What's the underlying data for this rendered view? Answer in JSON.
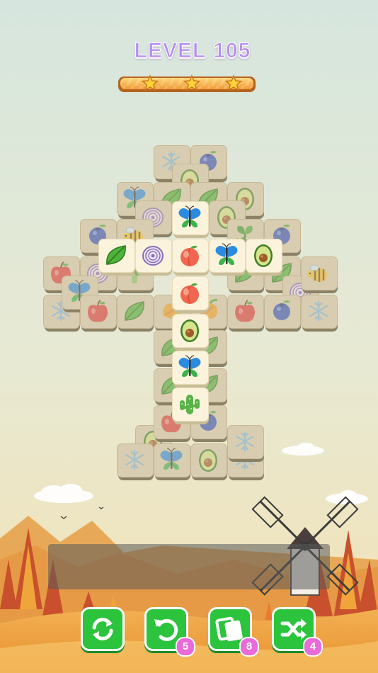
{
  "level": {
    "label": "LEVEL",
    "number": "105"
  },
  "stars": {
    "earned": 3,
    "total": 3
  },
  "colors": {
    "tool_green": "#2bc43c",
    "badge_pink": "#e86bd8",
    "level_purple": "#b48cf0",
    "sky": "#cfe2d6"
  },
  "tiles": [
    {
      "face": "snowflake",
      "state": "dim"
    },
    {
      "face": "blueberry",
      "state": "dim"
    },
    {
      "face": "avocado",
      "state": "dim"
    },
    {
      "face": "butterfly",
      "state": "dim"
    },
    {
      "face": "leaf",
      "state": "dim"
    },
    {
      "face": "leaf",
      "state": "dim"
    },
    {
      "face": "avocado",
      "state": "dim"
    },
    {
      "face": "onion",
      "state": "dim"
    },
    {
      "face": "avocado",
      "state": "dim"
    },
    {
      "face": "blueberry",
      "state": "dim"
    },
    {
      "face": "bee",
      "state": "dim"
    },
    {
      "face": "spinach",
      "state": "dim"
    },
    {
      "face": "blueberry",
      "state": "dim"
    },
    {
      "face": "apple",
      "state": "dim"
    },
    {
      "face": "onion",
      "state": "dim"
    },
    {
      "face": "broccoli",
      "state": "dim"
    },
    {
      "face": "leaf",
      "state": "dim"
    },
    {
      "face": "snowflake",
      "state": "dim"
    },
    {
      "face": "butterfly",
      "state": "dim"
    },
    {
      "face": "leaf",
      "state": "dim"
    },
    {
      "face": "bee",
      "state": "dim"
    },
    {
      "face": "leaf",
      "state": "dim"
    },
    {
      "face": "onion",
      "state": "dim"
    },
    {
      "face": "snowflake",
      "state": "dim"
    },
    {
      "face": "apple",
      "state": "dim"
    },
    {
      "face": "leaf",
      "state": "dim"
    },
    {
      "face": "mango",
      "state": "dim"
    },
    {
      "face": "mango",
      "state": "dim"
    },
    {
      "face": "apple",
      "state": "dim"
    },
    {
      "face": "blueberry",
      "state": "dim"
    },
    {
      "face": "bee",
      "state": "dim"
    },
    {
      "face": "blueberry",
      "state": "dim"
    },
    {
      "face": "leaf",
      "state": "dim"
    },
    {
      "face": "leaf",
      "state": "dim"
    },
    {
      "face": "leaf",
      "state": "dim"
    },
    {
      "face": "leaf",
      "state": "dim"
    },
    {
      "face": "avocado",
      "state": "dim"
    },
    {
      "face": "apple",
      "state": "dim"
    },
    {
      "face": "blueberry",
      "state": "dim"
    },
    {
      "face": "snowflake",
      "state": "dim"
    },
    {
      "face": "butterfly",
      "state": "dim"
    },
    {
      "face": "avocado",
      "state": "dim"
    },
    {
      "face": "snowflake",
      "state": "dim"
    },
    {
      "face": "snowflake",
      "state": "dim"
    },
    {
      "face": "butterfly",
      "state": "active"
    },
    {
      "face": "leaf",
      "state": "active"
    },
    {
      "face": "onion",
      "state": "active"
    },
    {
      "face": "peach",
      "state": "active"
    },
    {
      "face": "butterfly",
      "state": "active"
    },
    {
      "face": "avocado",
      "state": "active"
    },
    {
      "face": "peach",
      "state": "active"
    },
    {
      "face": "avocado",
      "state": "active"
    },
    {
      "face": "butterfly",
      "state": "active"
    },
    {
      "face": "cactus",
      "state": "active"
    }
  ],
  "tray": {
    "slots": 7,
    "filled": 0
  },
  "tools": [
    {
      "name": "refresh",
      "icon": "refresh-icon",
      "count": ""
    },
    {
      "name": "undo",
      "icon": "undo-icon",
      "count": "5"
    },
    {
      "name": "hint",
      "icon": "cards-icon",
      "count": "8"
    },
    {
      "name": "shuffle",
      "icon": "shuffle-icon",
      "count": "4"
    }
  ]
}
